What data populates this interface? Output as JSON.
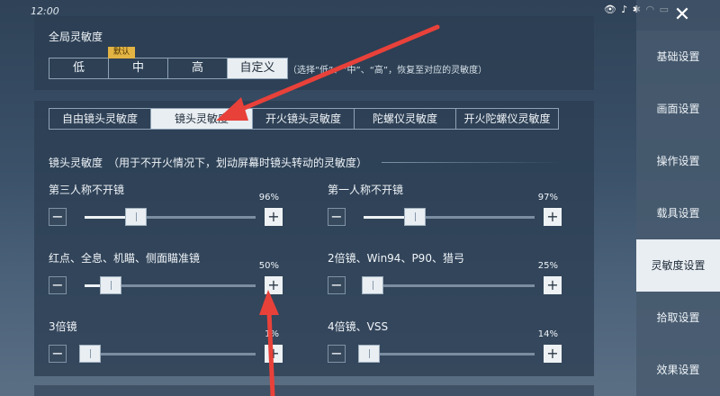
{
  "status_bar": {
    "time": "12:00",
    "icons": "👁 ♪ ✱ ◠ ▭"
  },
  "close_label": "✕",
  "global": {
    "title": "全局灵敏度",
    "options": [
      "低",
      "中",
      "高",
      "自定义"
    ],
    "selected": "自定义",
    "default_tag": "默认",
    "hint": "（选择“低”、“中”、“高”，恢复至对应的灵敏度）"
  },
  "tabs": {
    "items": [
      "自由镜头灵敏度",
      "镜头灵敏度",
      "开火镜头灵敏度",
      "陀螺仪灵敏度",
      "开火陀螺仪灵敏度"
    ],
    "selected": "镜头灵敏度"
  },
  "description": "镜头灵敏度　（用于不开火情况下，划动屏幕时镜头转动的灵敏度）",
  "sliders": [
    {
      "label": "第三人称不开镜",
      "pct_text": "96%",
      "level": 0.3,
      "minus": "−",
      "plus": "+"
    },
    {
      "label": "第一人称不开镜",
      "pct_text": "97%",
      "level": 0.3,
      "minus": "−",
      "plus": "+"
    },
    {
      "label": "红点、全息、机瞄、侧面瞄准镜",
      "pct_text": "50%",
      "level": 0.15,
      "minus": "−",
      "plus": "+"
    },
    {
      "label": "2倍镜、Win94、P90、猎弓",
      "pct_text": "25%",
      "level": 0.05,
      "minus": "−",
      "plus": "+"
    },
    {
      "label": "3倍镜",
      "pct_text": "1%",
      "level": 0.03,
      "minus": "−",
      "plus": "+"
    },
    {
      "label": "4倍镜、VSS",
      "pct_text": "14%",
      "level": 0.03,
      "minus": "−",
      "plus": "+"
    }
  ],
  "sidebar": {
    "items": [
      "基础设置",
      "画面设置",
      "操作设置",
      "载具设置",
      "灵敏度设置",
      "拾取设置",
      "效果设置"
    ],
    "selected": "灵敏度设置"
  },
  "colors": {
    "arrow": "#e8413a",
    "default_tag": "#e3b444",
    "active_bg": "#e9eef2"
  }
}
